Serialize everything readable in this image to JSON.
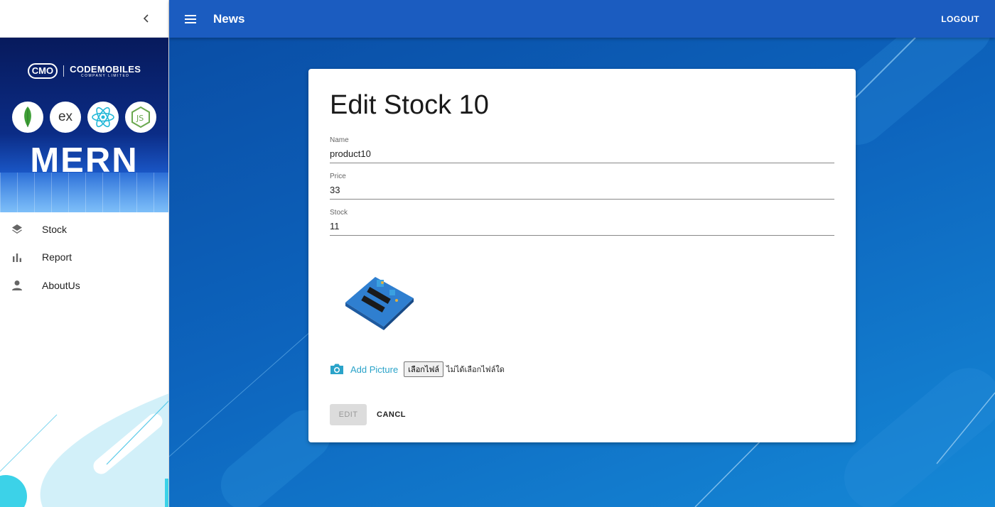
{
  "sidebar": {
    "brand_logo": "CMO",
    "brand_name": "CODEMOBILES",
    "brand_sub": "COMPANY LIMITED",
    "tech_ex": "ex",
    "banner_text": "MERN",
    "items": [
      {
        "label": "Stock",
        "icon": "layers-icon"
      },
      {
        "label": "Report",
        "icon": "bar-chart-icon"
      },
      {
        "label": "AboutUs",
        "icon": "person-icon"
      }
    ]
  },
  "appbar": {
    "title": "News",
    "logout": "LOGOUT"
  },
  "form": {
    "title": "Edit Stock 10",
    "fields": [
      {
        "label": "Name",
        "value": "product10"
      },
      {
        "label": "Price",
        "value": "33"
      },
      {
        "label": "Stock",
        "value": "11"
      }
    ],
    "add_picture": "Add Picture",
    "file_button": "เลือกไฟล์",
    "file_status": "ไม่ได้เลือกไฟล์ใด",
    "edit_button": "EDIT",
    "cancel_button": "CANCL"
  },
  "colors": {
    "appbar": "#1b5cc0",
    "accent": "#2aa3c9"
  }
}
